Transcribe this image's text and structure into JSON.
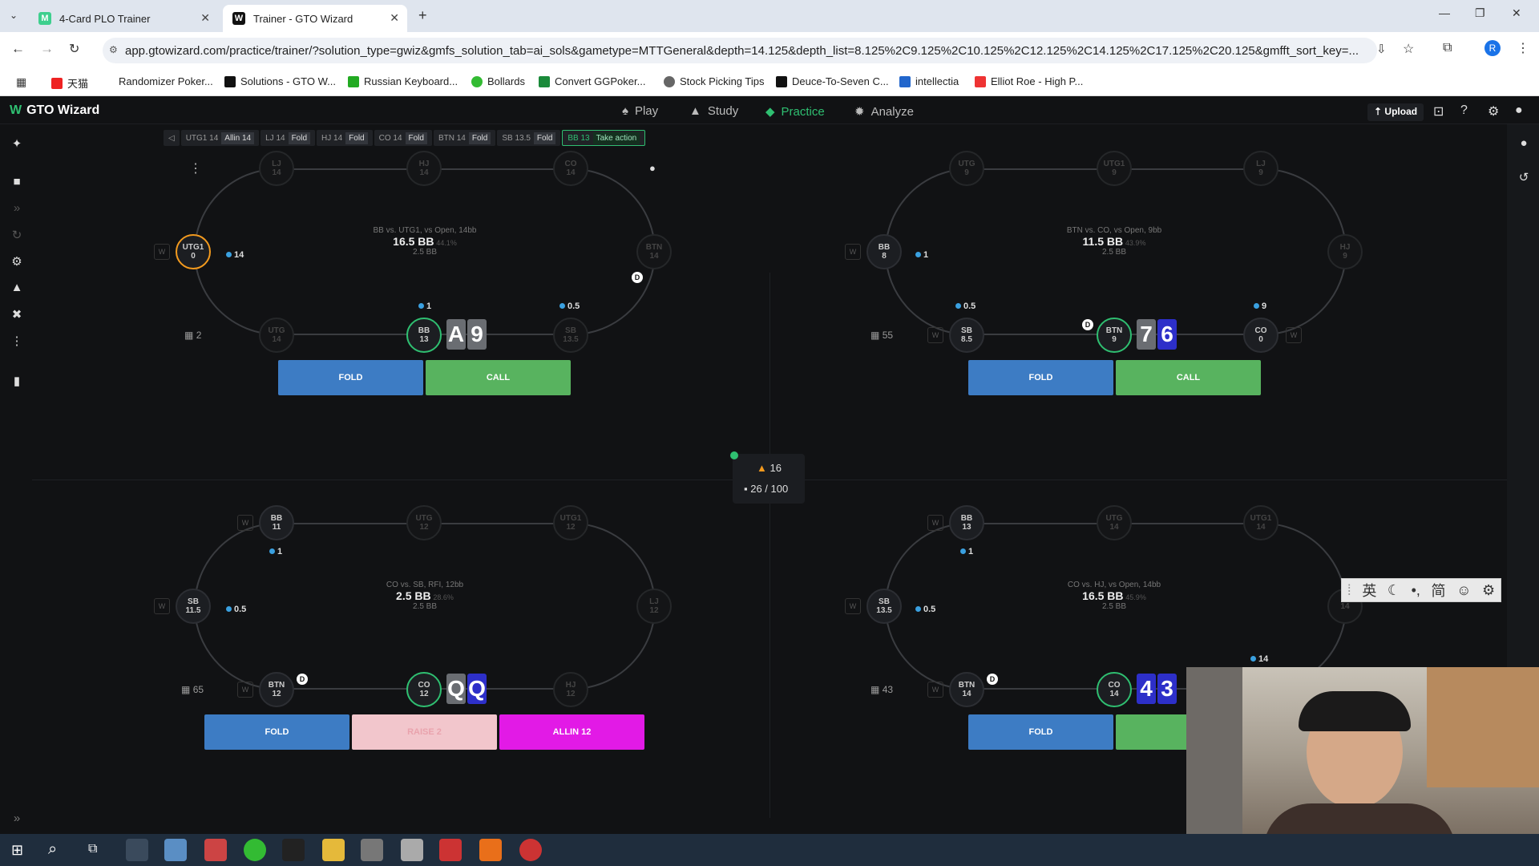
{
  "browser": {
    "tabs": [
      {
        "title": "4-Card PLO Trainer"
      },
      {
        "title": "Trainer - GTO Wizard"
      }
    ],
    "url": "app.gtowizard.com/practice/trainer/?solution_type=gwiz&gmfs_solution_tab=ai_sols&gametype=MTTGeneral&depth=14.125&depth_list=8.125%2C9.125%2C10.125%2C12.125%2C14.125%2C17.125%2C20.125&gmfft_sort_key=...",
    "bookmarks": [
      "天猫",
      "Randomizer Poker...",
      "Solutions - GTO W...",
      "Russian Keyboard...",
      "Bollards",
      "Convert GGPoker...",
      "Stock Picking Tips",
      "Deuce-To-Seven C...",
      "intellectia",
      "Elliot Roe - High P..."
    ],
    "profile_initial": "R"
  },
  "app": {
    "logo": "GTO Wizard",
    "nav": [
      "Play",
      "Study",
      "Practice",
      "Analyze"
    ],
    "upload": "Upload"
  },
  "action_bar": [
    {
      "pos": "UTG1",
      "stack": "14",
      "action": "Allin 14"
    },
    {
      "pos": "LJ",
      "stack": "14",
      "action": "Fold"
    },
    {
      "pos": "HJ",
      "stack": "14",
      "action": "Fold"
    },
    {
      "pos": "CO",
      "stack": "14",
      "action": "Fold"
    },
    {
      "pos": "BTN",
      "stack": "14",
      "action": "Fold"
    },
    {
      "pos": "SB",
      "stack": "13.5",
      "action": "Fold"
    },
    {
      "pos": "BB",
      "stack": "13",
      "action": "Take action"
    }
  ],
  "tables": {
    "t1": {
      "spot": "BB vs. UTG1, vs Open, 14bb",
      "pot": "16.5 BB",
      "pct": "44.1%",
      "sub": "2.5 BB",
      "seats": {
        "lj": "LJ\n14",
        "hj": "HJ\n14",
        "co": "CO\n14",
        "utg1": "UTG1\n0",
        "btn": "BTN\n14",
        "utg": "UTG\n14",
        "bb": "BB\n13",
        "sb": "SB\n13.5"
      },
      "bets": {
        "utg1": "14",
        "bb": "1",
        "sb": "0.5"
      },
      "cards": [
        "A",
        "9"
      ],
      "count": "2",
      "buttons": [
        "FOLD",
        "CALL"
      ]
    },
    "t2": {
      "spot": "BTN vs. CO, vs Open, 9bb",
      "pot": "11.5 BB",
      "pct": "43.9%",
      "sub": "2.5 BB",
      "seats": {
        "utg": "UTG\n9",
        "utg1": "UTG1\n9",
        "lj": "LJ\n9",
        "bb": "BB\n8",
        "hj": "HJ\n9",
        "sb": "SB\n8.5",
        "btn": "BTN\n9",
        "co": "CO\n0"
      },
      "bets": {
        "bb": "1",
        "sb": "0.5",
        "co": "9"
      },
      "cards": [
        "7",
        "6"
      ],
      "count": "55",
      "buttons": [
        "FOLD",
        "CALL"
      ]
    },
    "t3": {
      "spot": "CO vs. SB, RFI, 12bb",
      "pot": "2.5 BB",
      "pct": "28.6%",
      "sub": "2.5 BB",
      "seats": {
        "bb": "BB\n11",
        "utg": "UTG\n12",
        "utg1": "UTG1\n12",
        "sb": "SB\n11.5",
        "lj": "LJ\n12",
        "btn": "BTN\n12",
        "co": "CO\n12",
        "hj": "HJ\n12"
      },
      "bets": {
        "bb": "1",
        "sb": "0.5"
      },
      "cards": [
        "Q",
        "Q"
      ],
      "count": "65",
      "buttons": [
        "FOLD",
        "RAISE 2",
        "ALLIN 12"
      ]
    },
    "t4": {
      "spot": "CO vs. HJ, vs Open, 14bb",
      "pot": "16.5 BB",
      "pct": "45.9%",
      "sub": "2.5 BB",
      "seats": {
        "bb": "BB\n13",
        "utg": "UTG\n14",
        "utg1": "UTG1\n14",
        "sb": "SB\n13.5",
        "lj": "14",
        "btn": "BTN\n14",
        "co": "CO\n14"
      },
      "bets": {
        "bb": "1",
        "sb": "0.5",
        "hj": "14"
      },
      "cards": [
        "4",
        "3"
      ],
      "count": "43",
      "buttons": [
        "FOLD",
        "CA"
      ]
    }
  },
  "progress": {
    "streak": "16",
    "count": "26 / 100"
  },
  "ime": [
    "英",
    "简"
  ]
}
